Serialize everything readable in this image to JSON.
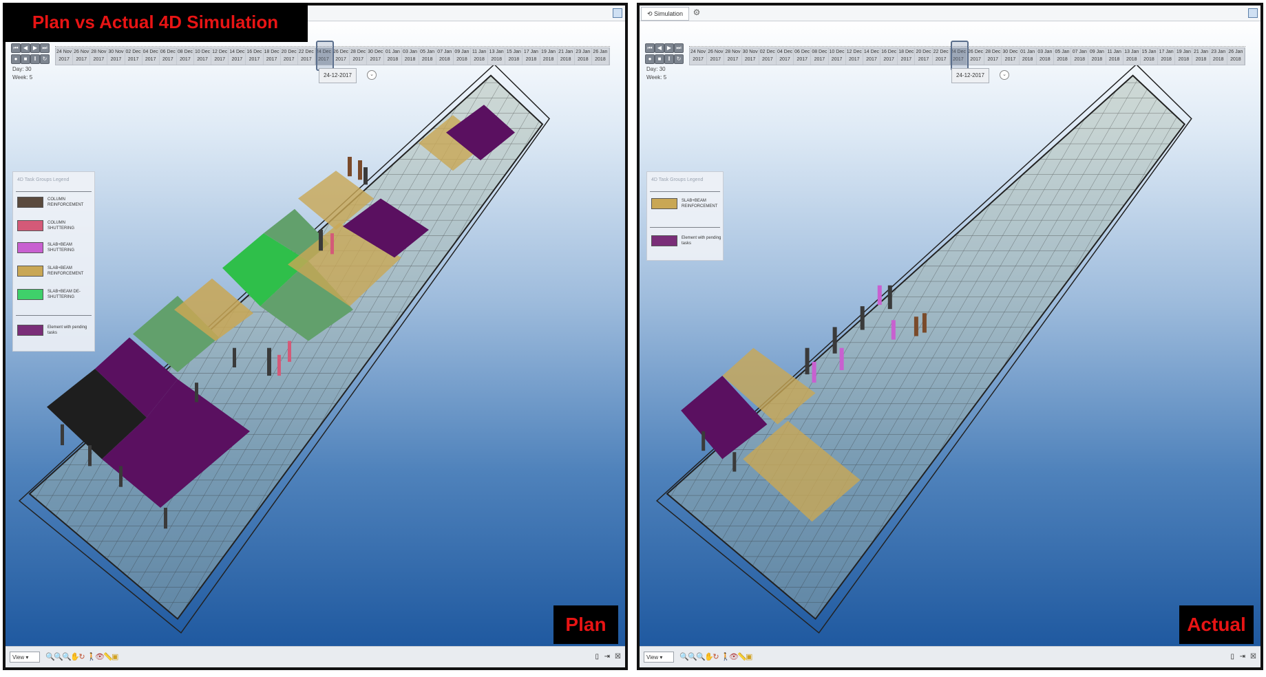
{
  "banner": {
    "title": "Plan vs Actual 4D Simulation"
  },
  "colors": {
    "column_reinforcement": "#5a4a3e",
    "column_shuttering": "#d45a78",
    "slab_beam_shuttering": "#c860d0",
    "slab_beam_reinforcement": "#c9a755",
    "slab_beam_deshuttering": "#3fd06a",
    "pending": "#7a2e78",
    "accent_label": "#e81414"
  },
  "timeline": {
    "dates": [
      {
        "day": "24 Nov",
        "year": "2017"
      },
      {
        "day": "26 Nov",
        "year": "2017"
      },
      {
        "day": "28 Nov",
        "year": "2017"
      },
      {
        "day": "30 Nov",
        "year": "2017"
      },
      {
        "day": "02 Dec",
        "year": "2017"
      },
      {
        "day": "04 Dec",
        "year": "2017"
      },
      {
        "day": "06 Dec",
        "year": "2017"
      },
      {
        "day": "08 Dec",
        "year": "2017"
      },
      {
        "day": "10 Dec",
        "year": "2017"
      },
      {
        "day": "12 Dec",
        "year": "2017"
      },
      {
        "day": "14 Dec",
        "year": "2017"
      },
      {
        "day": "16 Dec",
        "year": "2017"
      },
      {
        "day": "18 Dec",
        "year": "2017"
      },
      {
        "day": "20 Dec",
        "year": "2017"
      },
      {
        "day": "22 Dec",
        "year": "2017"
      },
      {
        "day": "24 Dec",
        "year": "2017"
      },
      {
        "day": "26 Dec",
        "year": "2017"
      },
      {
        "day": "28 Dec",
        "year": "2017"
      },
      {
        "day": "30 Dec",
        "year": "2017"
      },
      {
        "day": "01 Jan",
        "year": "2018"
      },
      {
        "day": "03 Jan",
        "year": "2018"
      },
      {
        "day": "05 Jan",
        "year": "2018"
      },
      {
        "day": "07 Jan",
        "year": "2018"
      },
      {
        "day": "09 Jan",
        "year": "2018"
      },
      {
        "day": "11 Jan",
        "year": "2018"
      },
      {
        "day": "13 Jan",
        "year": "2018"
      },
      {
        "day": "15 Jan",
        "year": "2018"
      },
      {
        "day": "17 Jan",
        "year": "2018"
      },
      {
        "day": "19 Jan",
        "year": "2018"
      },
      {
        "day": "21 Jan",
        "year": "2018"
      },
      {
        "day": "23 Jan",
        "year": "2018"
      },
      {
        "day": "26 Jan",
        "year": "2018"
      }
    ],
    "active_index": 15
  },
  "panels": {
    "plan": {
      "label": "Plan",
      "day_label": "Day:",
      "day_value": "30",
      "week_label": "Week:",
      "week_value": "5",
      "current_date": "24-12-2017",
      "legend_title": "4D Task Groups Legend",
      "legend": [
        {
          "label": "COLUMN REINFORCEMENT",
          "color": "#5a4a3e"
        },
        {
          "label": "COLUMN SHUTTERING",
          "color": "#d45a78"
        },
        {
          "label": "SLAB+BEAM SHUTTERING",
          "color": "#c860d0"
        },
        {
          "label": "SLAB+BEAM REINFORCEMENT",
          "color": "#c9a755"
        },
        {
          "label": "SLAB+BEAM DE-SHUTTERING",
          "color": "#3fd06a"
        },
        {
          "label": "Element with pending tasks",
          "color": "#7a2e78"
        }
      ],
      "view_select": "View",
      "tab_label": ""
    },
    "actual": {
      "label": "Actual",
      "day_label": "Day:",
      "day_value": "30",
      "week_label": "Week:",
      "week_value": "5",
      "current_date": "24-12-2017",
      "legend_title": "4D Task Groups Legend",
      "legend": [
        {
          "label": "SLAB+BEAM REINFORCEMENT",
          "color": "#c9a755"
        },
        {
          "label": "Element with pending tasks",
          "color": "#7a2e78"
        }
      ],
      "view_select": "View",
      "tab_label": "Simulation"
    }
  }
}
